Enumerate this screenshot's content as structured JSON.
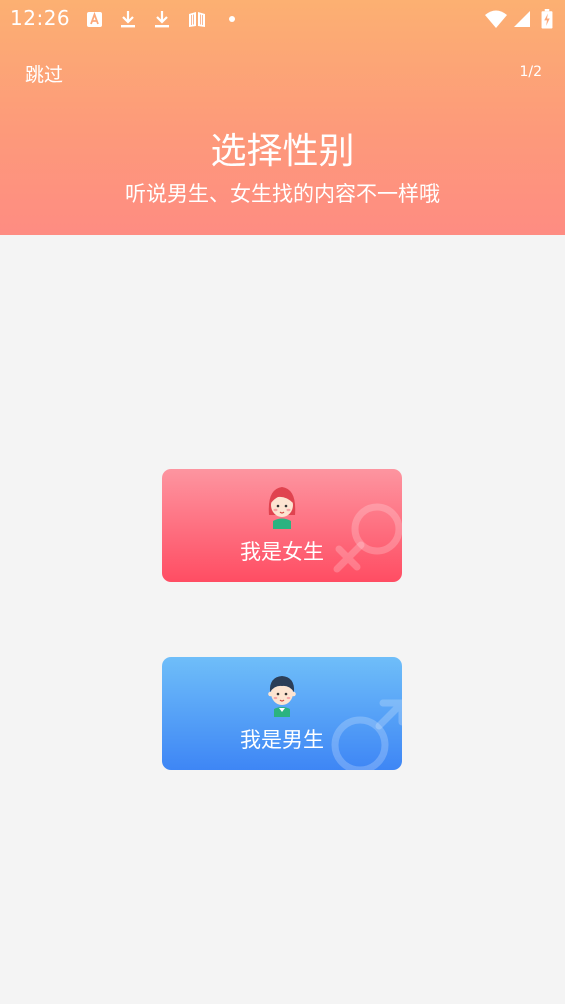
{
  "status_bar": {
    "time": "12:26",
    "icons": [
      "translate-icon",
      "download-icon",
      "download-icon",
      "book-icon",
      "dot-icon",
      "wifi-icon",
      "signal-icon",
      "battery-charging-icon"
    ]
  },
  "header": {
    "skip_label": "跳过",
    "page_indicator": "1/2",
    "title": "选择性别",
    "subtitle": "听说男生、女生找的内容不一样哦"
  },
  "options": {
    "female": {
      "label": "我是女生",
      "icon": "female-avatar-icon",
      "symbol": "female-symbol-icon",
      "color": "#ff4d63"
    },
    "male": {
      "label": "我是男生",
      "icon": "male-avatar-icon",
      "symbol": "male-symbol-icon",
      "color": "#3e86f5"
    }
  },
  "colors": {
    "header_top": "#fcb072",
    "header_bottom": "#fe8c82",
    "background": "#f4f4f4"
  }
}
